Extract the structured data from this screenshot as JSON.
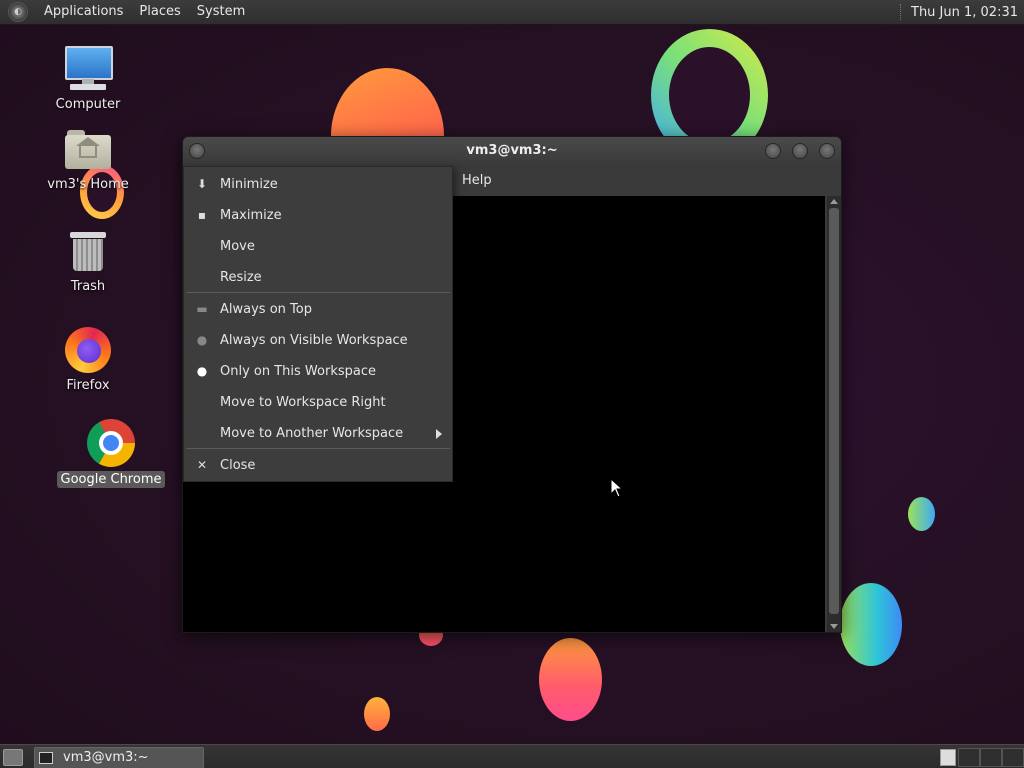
{
  "top_panel": {
    "menus": [
      "Applications",
      "Places",
      "System"
    ],
    "clock": "Thu Jun  1, 02:31"
  },
  "desktop_icons": [
    {
      "label": "Computer",
      "icon": "computer-icon"
    },
    {
      "label": "vm3's Home",
      "icon": "home-folder-icon"
    },
    {
      "label": "Trash",
      "icon": "trash-icon"
    },
    {
      "label": "Firefox",
      "icon": "firefox-icon"
    },
    {
      "label": "Google Chrome",
      "icon": "chrome-icon",
      "selected": true
    }
  ],
  "window": {
    "title": "vm3@vm3:~",
    "menu_help": "Help"
  },
  "context_menu": {
    "items": [
      {
        "label": "Minimize",
        "icon": "minimize-icon"
      },
      {
        "label": "Maximize",
        "icon": "maximize-icon"
      },
      {
        "label": "Move",
        "icon": ""
      },
      {
        "label": "Resize",
        "icon": ""
      },
      {
        "label": "Always on Top",
        "icon": "always-on-top-icon"
      },
      {
        "label": "Always on Visible Workspace",
        "icon": "sticky-icon"
      },
      {
        "label": "Only on This Workspace",
        "icon": "radio-bullet-icon",
        "selected": true
      },
      {
        "label": "Move to Workspace Right",
        "icon": ""
      },
      {
        "label": "Move to Another Workspace",
        "icon": "",
        "submenu": true
      },
      {
        "label": "Close",
        "icon": "close-icon"
      }
    ]
  },
  "taskbar": {
    "task_label": "vm3@vm3:~"
  }
}
